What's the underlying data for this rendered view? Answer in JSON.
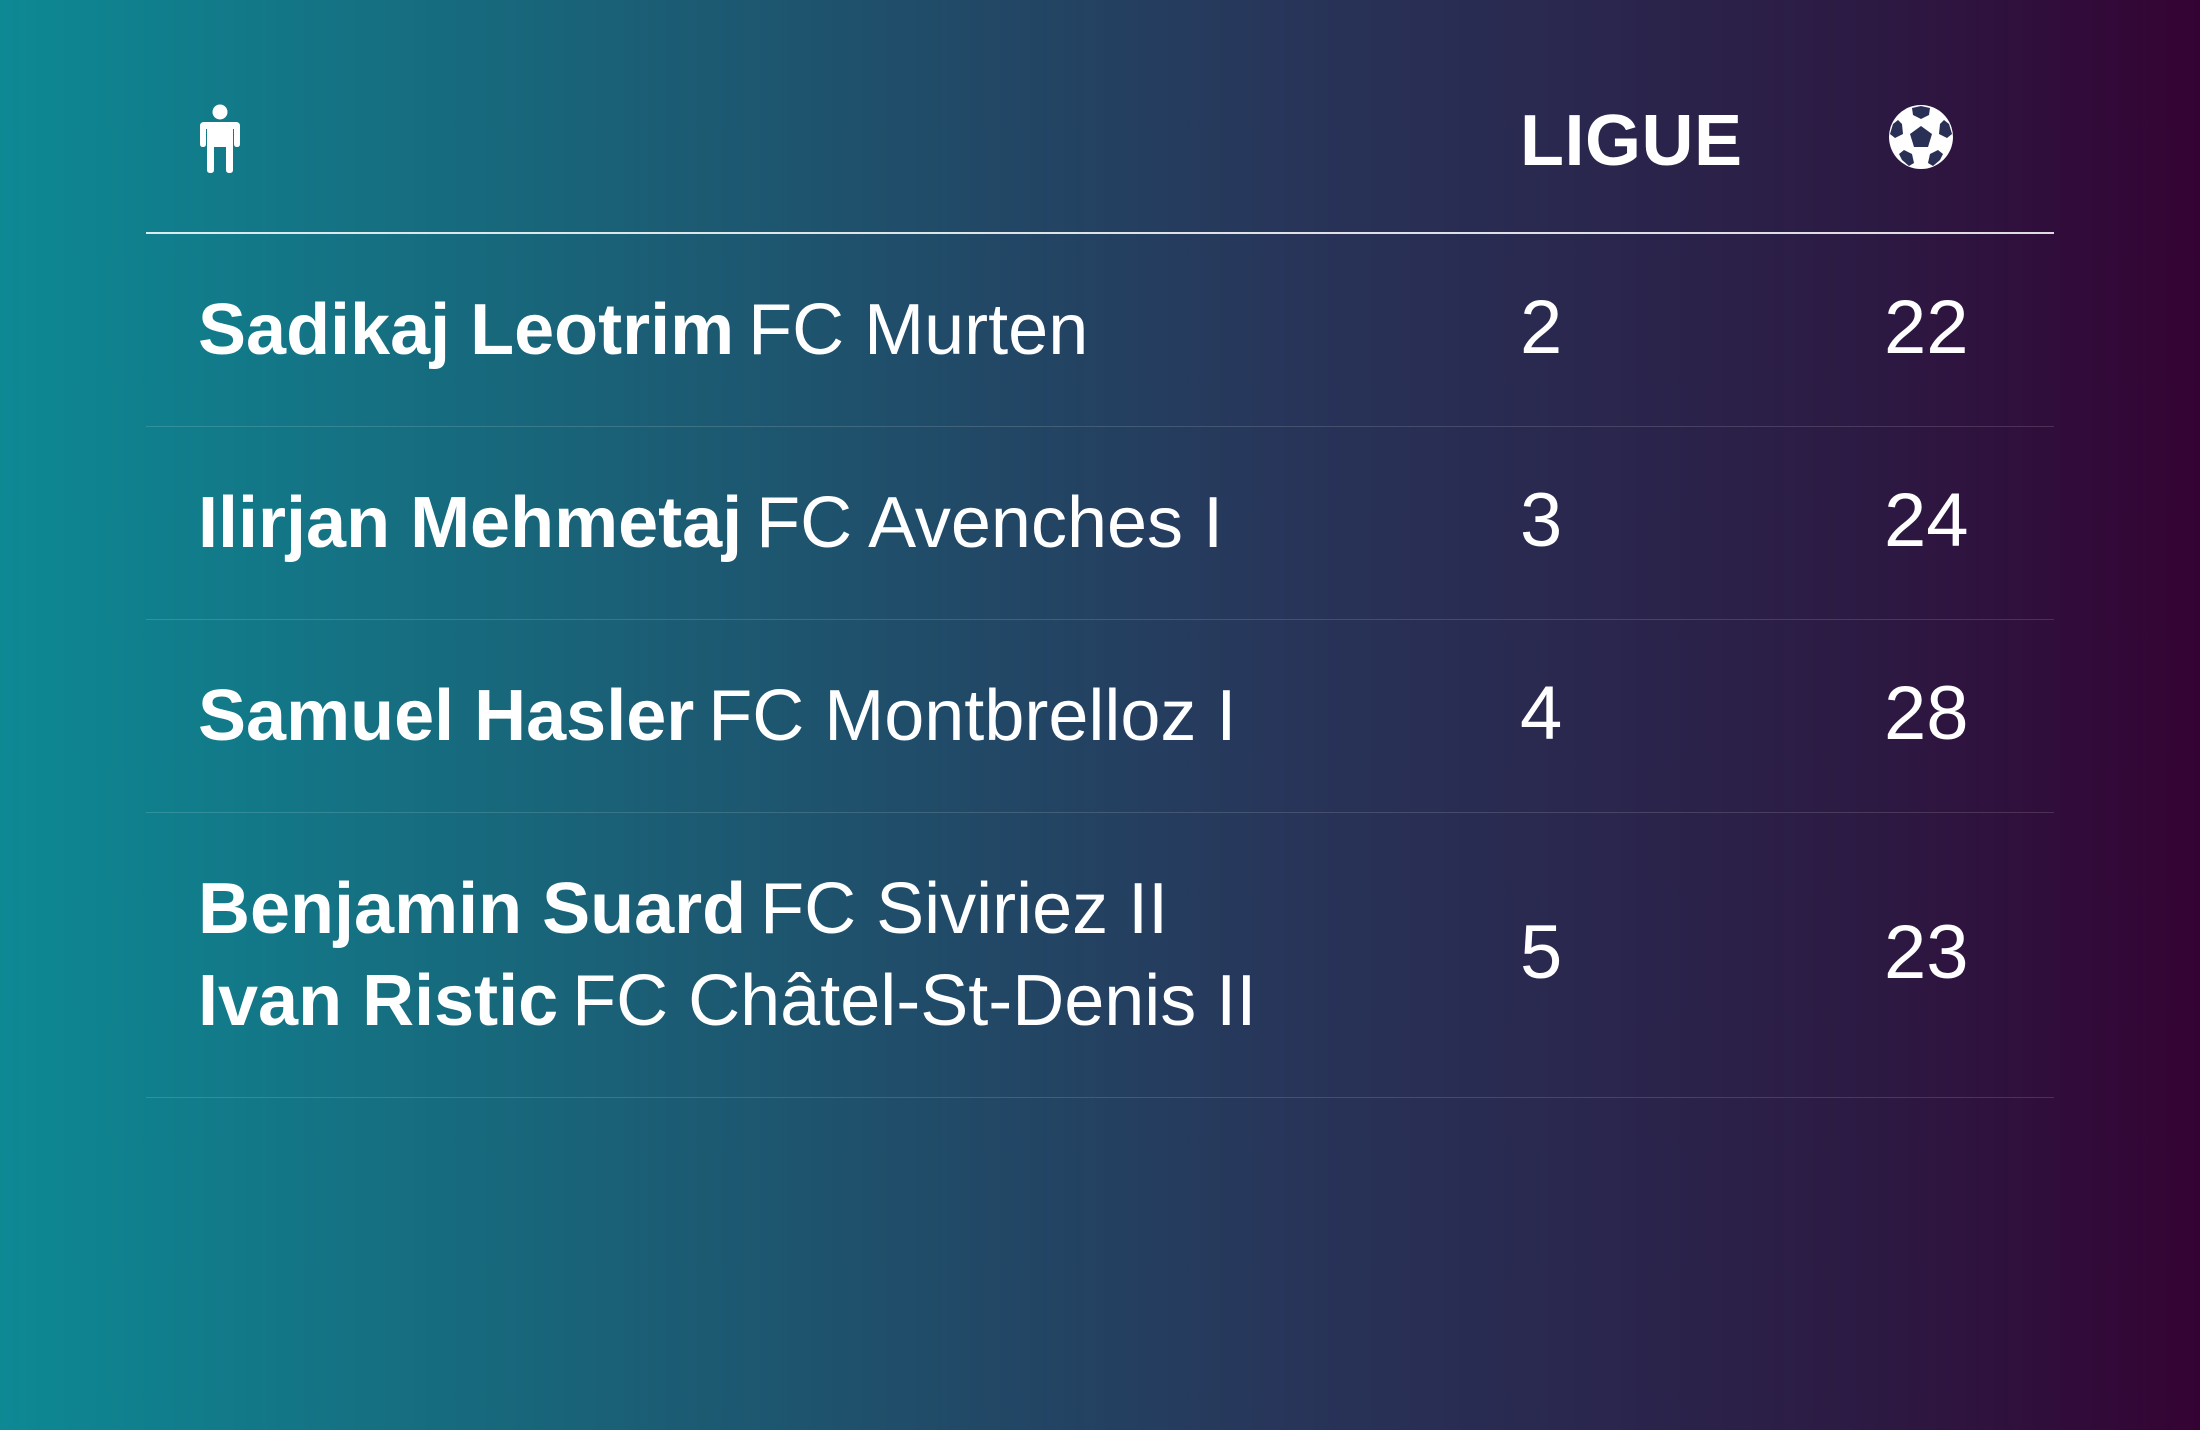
{
  "header": {
    "player_icon": "person-icon",
    "league_label": "LIGUE",
    "goals_icon": "soccer-ball-icon"
  },
  "rows": [
    {
      "players": [
        {
          "name": "Sadikaj Leotrim",
          "club": "FC Murten"
        }
      ],
      "league": "2",
      "goals": "22"
    },
    {
      "players": [
        {
          "name": "Ilirjan Mehmetaj",
          "club": "FC Avenches I"
        }
      ],
      "league": "3",
      "goals": "24"
    },
    {
      "players": [
        {
          "name": "Samuel Hasler",
          "club": "FC Montbrelloz I"
        }
      ],
      "league": "4",
      "goals": "28"
    },
    {
      "players": [
        {
          "name": "Benjamin Suard",
          "club": "FC Siviriez II"
        },
        {
          "name": "Ivan Ristic",
          "club": "FC Châtel-St-Denis II"
        }
      ],
      "league": "5",
      "goals": "23"
    }
  ]
}
